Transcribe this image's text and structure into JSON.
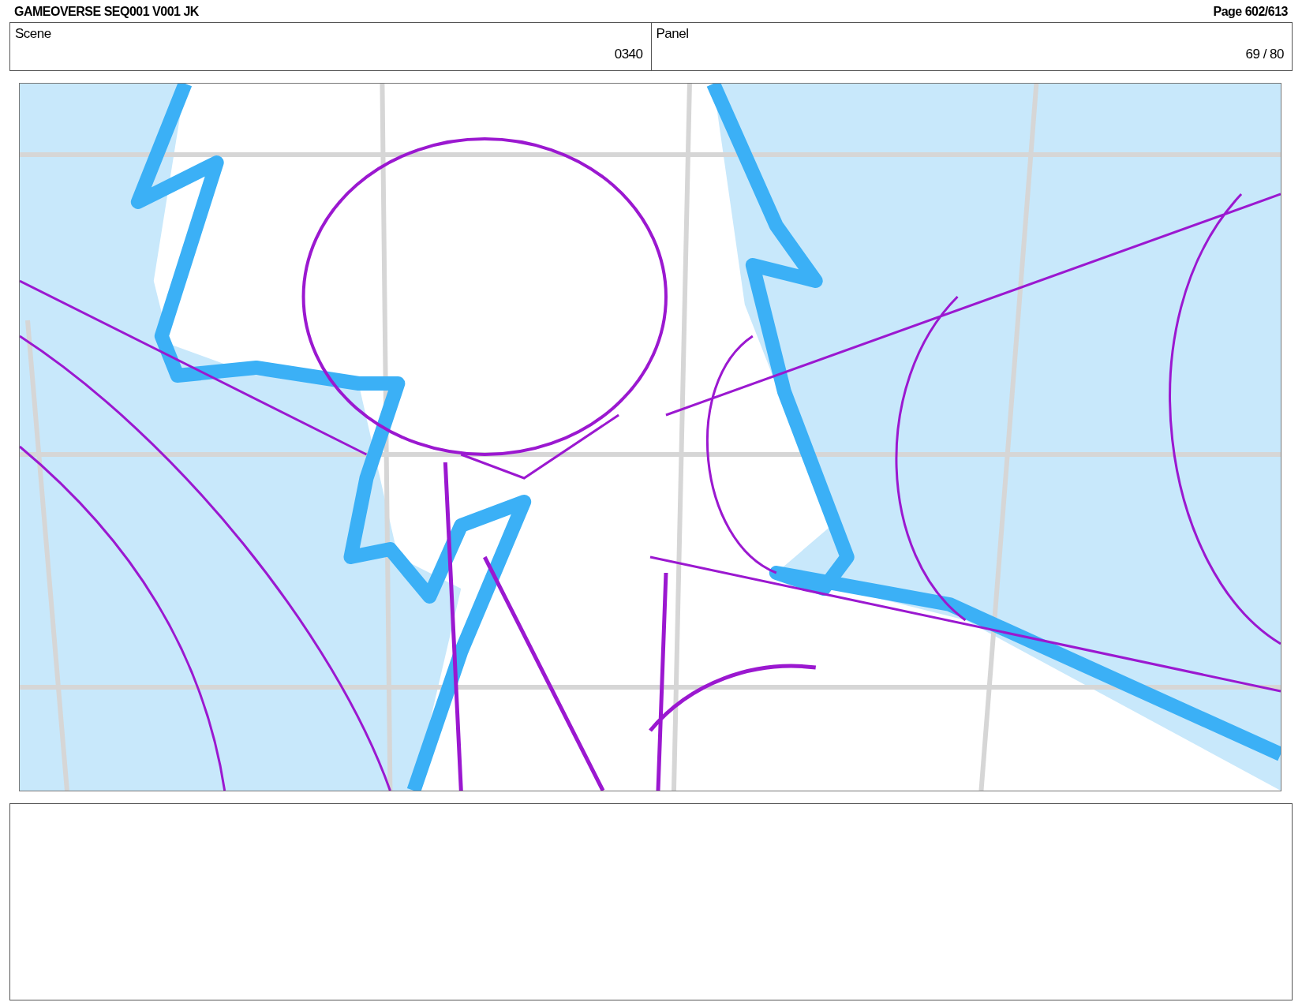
{
  "header": {
    "title": "GAMEOVERSE SEQ001 V001 JK",
    "page": "Page 602/613"
  },
  "fields": [
    {
      "label": "Scene",
      "value": "0340"
    },
    {
      "label": "Panel",
      "value": "69 / 80"
    }
  ]
}
